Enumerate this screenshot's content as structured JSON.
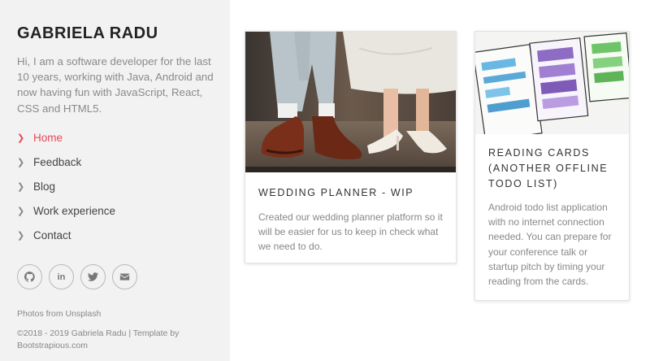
{
  "profile": {
    "name": "GABRIELA RADU",
    "bio": "Hi, I am a software developer for the last 10 years, working with Java, Android and now having fun with JavaScript, React, CSS and HTML5."
  },
  "nav": {
    "items": [
      {
        "label": "Home",
        "active": true
      },
      {
        "label": "Feedback",
        "active": false
      },
      {
        "label": "Blog",
        "active": false
      },
      {
        "label": "Work experience",
        "active": false
      },
      {
        "label": "Contact",
        "active": false
      }
    ]
  },
  "socials": [
    {
      "name": "github-icon"
    },
    {
      "name": "linkedin-icon",
      "text": "in"
    },
    {
      "name": "twitter-icon"
    },
    {
      "name": "email-icon"
    }
  ],
  "footer": {
    "photos_credit": "Photos from Unsplash",
    "copyright": "©2018 - 2019 Gabriela Radu | Template by Bootstrapious.com"
  },
  "cards": [
    {
      "title": "WEDDING PLANNER - WIP",
      "text": "Created our wedding planner platform so it will be easier for us to keep in check what we need to do."
    },
    {
      "title": "READING CARDS (ANOTHER OFFLINE TODO LIST)",
      "text": "Android todo list application with no internet connection needed. You can prepare for your conference talk or startup pitch by timing your reading from the cards."
    }
  ],
  "colors": {
    "accent": "#e8485b",
    "sidebar_bg": "#f2f2f2"
  }
}
